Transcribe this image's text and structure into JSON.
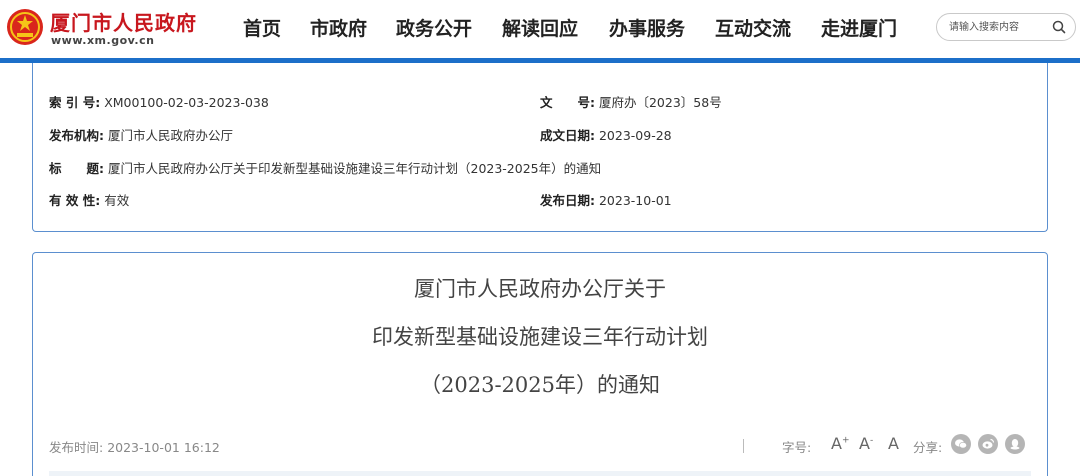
{
  "header": {
    "site_title": "厦门市人民政府",
    "site_url": "www.xm.gov.cn",
    "nav": [
      {
        "label": "首页"
      },
      {
        "label": "市政府"
      },
      {
        "label": "政务公开"
      },
      {
        "label": "解读回应"
      },
      {
        "label": "办事服务"
      },
      {
        "label": "互动交流"
      },
      {
        "label": "走进厦门"
      }
    ],
    "search": {
      "placeholder": "请输入搜索内容",
      "value": ""
    }
  },
  "info": {
    "index_label": "索 引 号:",
    "index_value": "XM00100-02-03-2023-038",
    "docno_label": "文　　号:",
    "docno_value": "厦府办〔2023〕58号",
    "issuer_label": "发布机构:",
    "issuer_value": "厦门市人民政府办公厅",
    "created_label": "成文日期:",
    "created_value": "2023-09-28",
    "title_label": "标　　题:",
    "title_value": "厦门市人民政府办公厅关于印发新型基础设施建设三年行动计划（2023-2025年）的通知",
    "validity_label": "有 效 性:",
    "validity_value": "有效",
    "published_label": "发布日期:",
    "published_value": "2023-10-01"
  },
  "article": {
    "title_line1": "厦门市人民政府办公厅关于",
    "title_line2": "印发新型基础设施建设三年行动计划",
    "title_line3": "（2023-2025年）的通知",
    "publish_time_label": "发布时间:",
    "publish_time_value": "2023-10-01 16:12",
    "font_size_label": "字号:",
    "font_larger": "A",
    "font_smaller": "A",
    "font_normal": "A",
    "share_label": "分享:",
    "share_icons": [
      "wechat-icon",
      "weibo-icon",
      "qq-icon"
    ]
  },
  "colors": {
    "brand_red": "#c8171e",
    "accent_blue": "#1c6fc9",
    "border_blue": "#5b8fcf"
  }
}
